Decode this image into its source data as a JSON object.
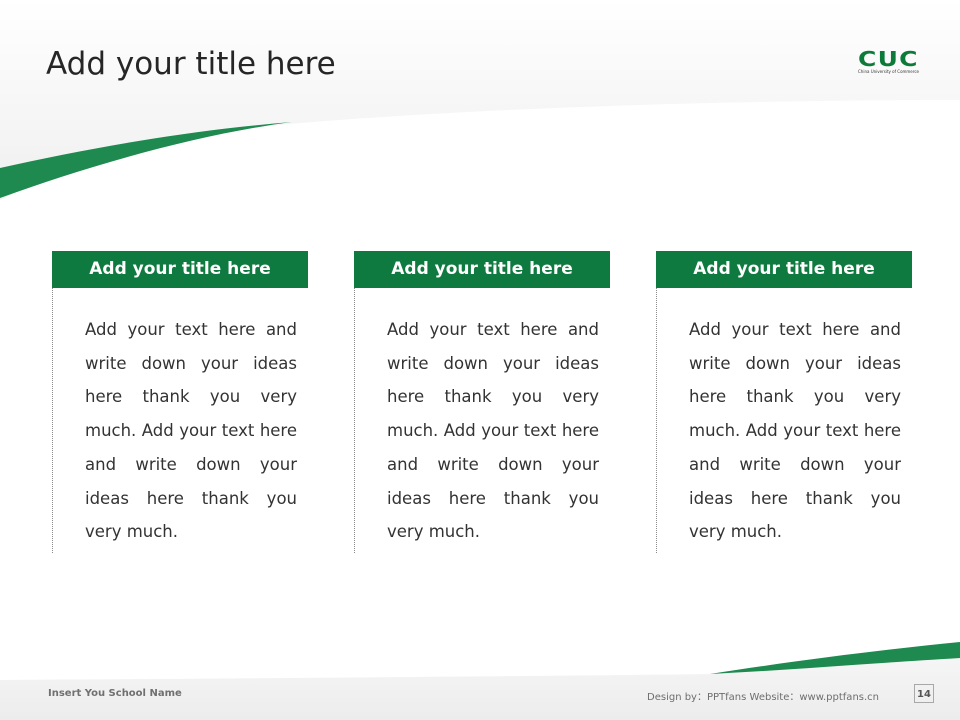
{
  "slide": {
    "title": "Add your title here",
    "logo": {
      "main": "CUC",
      "sub": "China University of Commerce"
    },
    "colors": {
      "accent": "#0f7a3f",
      "swoosh": "#1e8a50",
      "title_text": "#262626",
      "body_text": "#333333"
    },
    "cards": [
      {
        "title": "Add your title here",
        "body": "Add your text here and write down your ideas here thank you very much. Add your text here and write down your ideas here thank you very much."
      },
      {
        "title": "Add your title here",
        "body": "Add your text here and write down your ideas here thank you very much. Add your text here and write down your ideas here thank you very much."
      },
      {
        "title": "Add your title here",
        "body": "Add your text here and write down your ideas here thank you very much. Add your text here and write down your ideas here thank you very much."
      }
    ],
    "footer": {
      "school_name": "Insert You School Name",
      "credit": "Design by：PPTfans   Website：www.pptfans.cn",
      "page_number": "14"
    }
  }
}
